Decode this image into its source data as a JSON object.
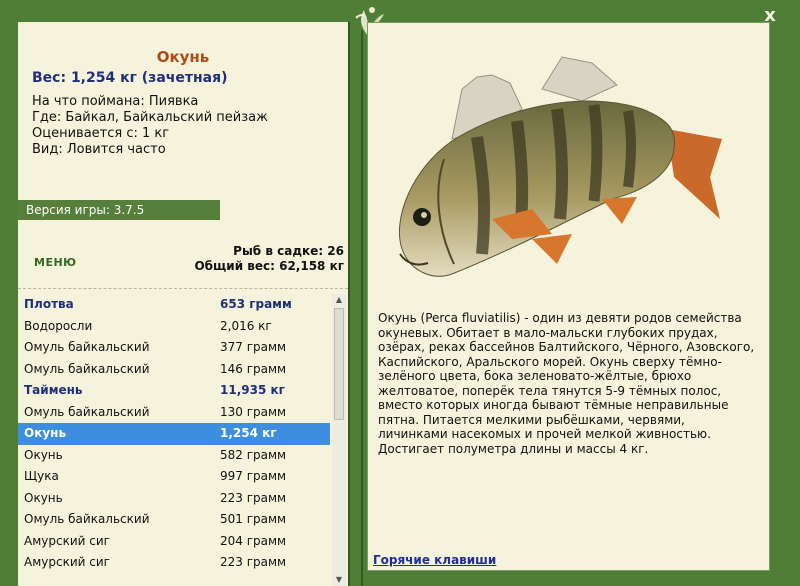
{
  "window": {
    "close_label": "x"
  },
  "fish": {
    "name": "Окунь",
    "weight": "Вес: 1,254 кг (зачетная)",
    "info": [
      "На что поймана: Пиявка",
      "Где: Байкал, Байкальский пейзаж",
      "Оценивается с: 1 кг",
      "Вид: Ловится часто"
    ],
    "description": "Окунь (Perca fluviatilis) - один из девяти родов семейства окуневых. Обитает в мало-мальски глубоких прудах, озёрах, реках бассейнов Балтийского, Чёрного, Азовского, Каспийского, Аральского морей. Окунь сверху тёмно-зелёного цвета, бока зеленовато-жёлтые, брюхо желтоватое, поперёк тела тянутся 5-9 тёмных полос, вместо которых иногда бывают тёмные неправильные пятна. Питается мелкими рыбёшками, червями, личинками насекомых и прочей мелкой живностью. Достигает полуметра длины и массы 4 кг."
  },
  "version": "Версия игры: 3.7.5",
  "menu_label": "МЕНЮ",
  "stats": {
    "count": "Рыб в садке: 26",
    "total": "Общий вес: 62,158 кг"
  },
  "catch_list": [
    {
      "name": "Плотва",
      "weight": "653 грамм",
      "style": "bold"
    },
    {
      "name": "Водоросли",
      "weight": "2,016 кг",
      "style": ""
    },
    {
      "name": "Омуль байкальский",
      "weight": "377 грамм",
      "style": ""
    },
    {
      "name": "Омуль байкальский",
      "weight": "146 грамм",
      "style": ""
    },
    {
      "name": "Таймень",
      "weight": "11,935 кг",
      "style": "bold"
    },
    {
      "name": "Омуль байкальский",
      "weight": "130 грамм",
      "style": ""
    },
    {
      "name": "Окунь",
      "weight": "1,254 кг",
      "style": "sel"
    },
    {
      "name": "Окунь",
      "weight": "582 грамм",
      "style": ""
    },
    {
      "name": "Щука",
      "weight": "997 грамм",
      "style": ""
    },
    {
      "name": "Окунь",
      "weight": "223 грамм",
      "style": ""
    },
    {
      "name": "Омуль байкальский",
      "weight": "501 грамм",
      "style": ""
    },
    {
      "name": "Амурский сиг",
      "weight": "204 грамм",
      "style": ""
    },
    {
      "name": "Амурский сиг",
      "weight": "223 грамм",
      "style": ""
    }
  ],
  "hotkeys_label": "Горячие клавиши",
  "colors": {
    "frame": "#4f7f37",
    "panel": "#f6f3dc",
    "selection": "#3e8ee0",
    "accent_name": "#b04a12",
    "heading": "#1f2f7a"
  },
  "icons": {
    "close": "close-icon",
    "ornament": "leaf-ornament-icon",
    "fish": "perch-fish-image"
  }
}
